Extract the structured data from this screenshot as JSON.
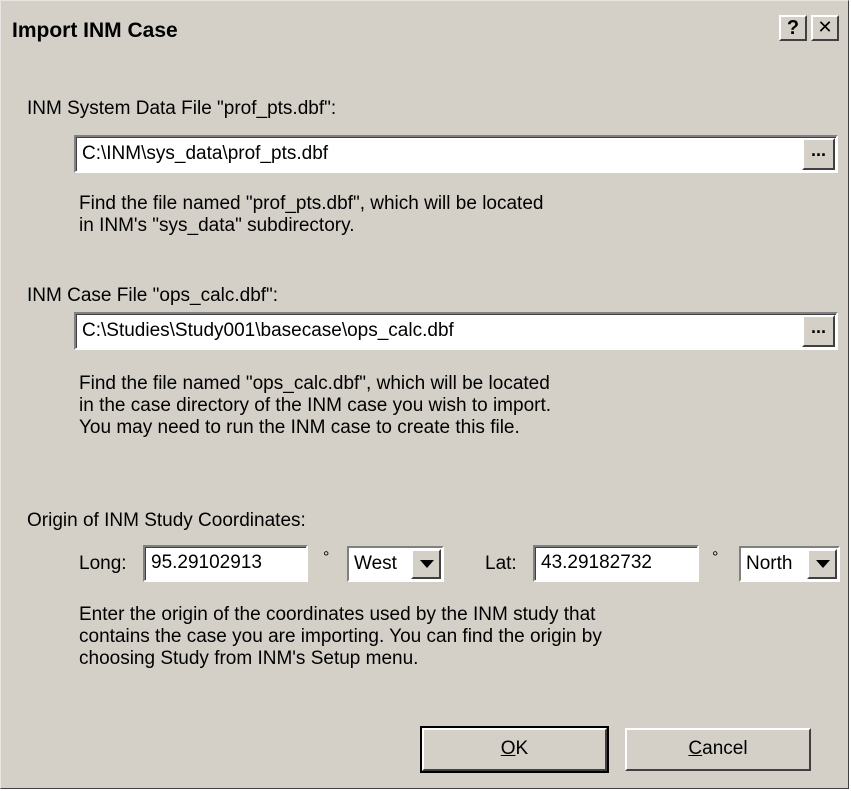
{
  "window": {
    "title": "Import INM Case",
    "help_label": "?",
    "close_label": "✕"
  },
  "system_file": {
    "label": "INM System Data File \"prof_pts.dbf\":",
    "value": "C:\\INM\\sys_data\\prof_pts.dbf",
    "browse_label": "...",
    "help_lines": [
      "Find the file named \"prof_pts.dbf\", which will be located",
      "in INM's \"sys_data\" subdirectory."
    ]
  },
  "case_file": {
    "label": "INM Case File \"ops_calc.dbf\":",
    "value": "C:\\Studies\\Study001\\basecase\\ops_calc.dbf",
    "browse_label": "...",
    "help_lines": [
      "Find the file named \"ops_calc.dbf\", which will be located",
      "in the case directory of the INM case you wish to import.",
      "You may need to run the INM case to create this file."
    ]
  },
  "origin": {
    "label": "Origin of INM Study Coordinates:",
    "long_label": "Long:",
    "long_value": "95.29102913",
    "long_deg": "°",
    "long_dir": "West",
    "lat_label": "Lat:",
    "lat_value": "43.29182732",
    "lat_deg": "°",
    "lat_dir": "North",
    "help_lines": [
      "Enter the origin of the coordinates used by the INM study that",
      "contains the case you are importing.  You can find the origin by",
      "choosing Study from INM's Setup menu."
    ]
  },
  "buttons": {
    "ok_mnemonic": "O",
    "ok_rest": "K",
    "cancel_mnemonic": "C",
    "cancel_rest": "ancel"
  }
}
